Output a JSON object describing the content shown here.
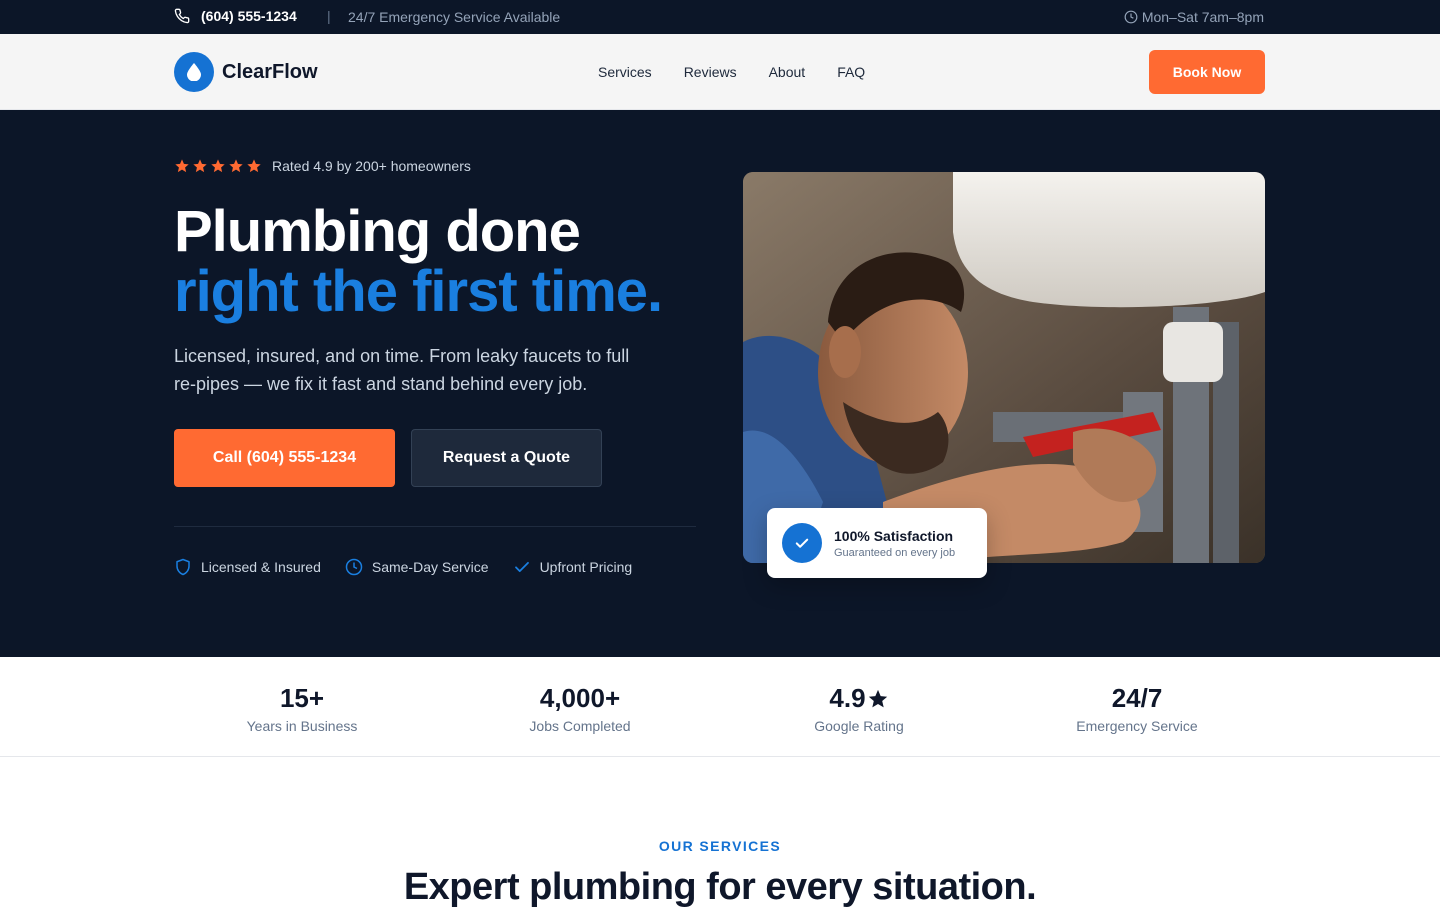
{
  "topbar": {
    "phone": "(604) 555-1234",
    "separator": "|",
    "emergency": "24/7 Emergency Service Available",
    "hours": "Mon–Sat 7am–8pm"
  },
  "nav": {
    "brand": "ClearFlow",
    "links": [
      "Services",
      "Reviews",
      "About",
      "FAQ"
    ],
    "cta": "Book Now"
  },
  "hero": {
    "rating_text": "Rated 4.9 by 200+ homeowners",
    "stars": 5,
    "headline_line1": "Plumbing done",
    "headline_line2": "right the first time.",
    "subtext": "Licensed, insured, and on time. From leaky faucets to full re-pipes — we fix it fast and stand behind every job.",
    "primary_cta": "Call (604) 555-1234",
    "secondary_cta": "Request a Quote",
    "features": [
      {
        "icon": "shield-icon",
        "label": "Licensed & Insured"
      },
      {
        "icon": "clock-icon",
        "label": "Same-Day Service"
      },
      {
        "icon": "check-icon",
        "label": "Upfront Pricing"
      }
    ],
    "badge": {
      "title": "100% Satisfaction",
      "subtitle": "Guaranteed on every job"
    }
  },
  "stats": [
    {
      "value": "15+",
      "label": "Years in Business"
    },
    {
      "value": "4,000+",
      "label": "Jobs Completed"
    },
    {
      "value": "4.9",
      "label": "Google Rating"
    },
    {
      "value": "24/7",
      "label": "Emergency Service"
    }
  ],
  "services": {
    "kicker": "OUR SERVICES",
    "title": "Expert plumbing for every situation."
  },
  "colors": {
    "navy": "#0c1628",
    "accent_orange": "#ff6a32",
    "brand_blue": "#1572d3",
    "star_orange": "#ff6a32"
  }
}
